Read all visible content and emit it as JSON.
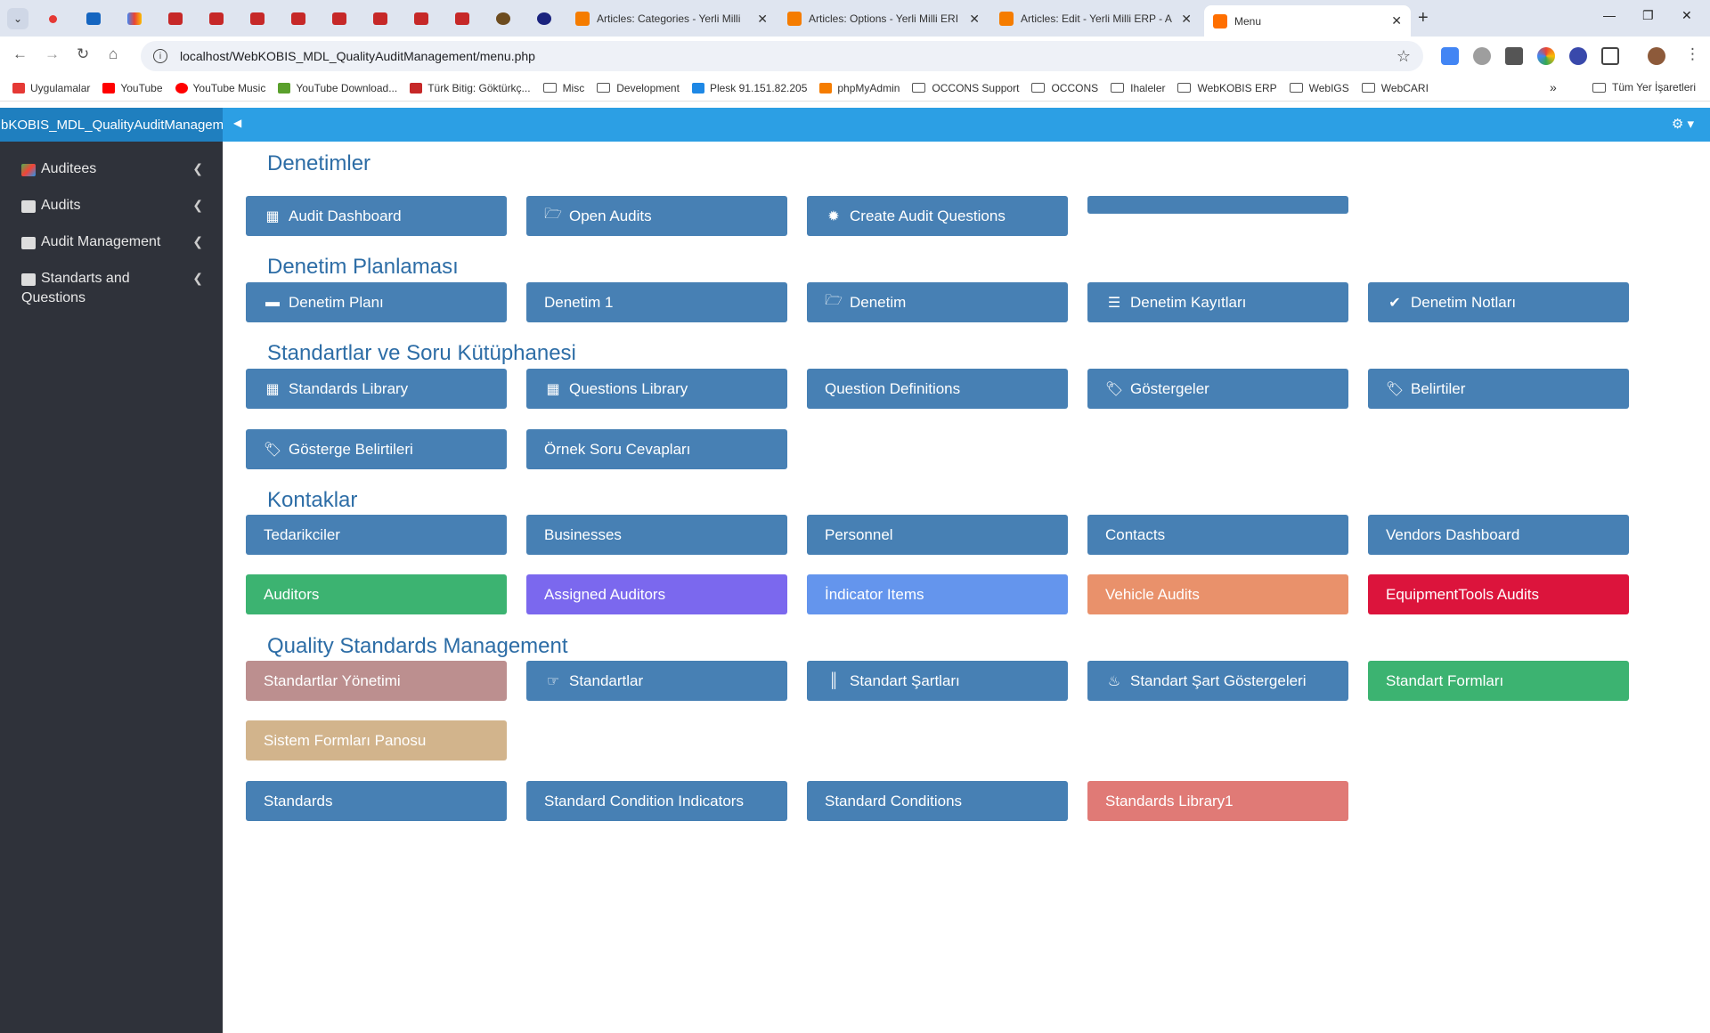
{
  "browser": {
    "active_tab": {
      "title": "Menu"
    },
    "tabs": [
      {
        "title": "Articles: Categories - Yerli Milli"
      },
      {
        "title": "Articles: Options - Yerli Milli ERI"
      },
      {
        "title": "Articles: Edit - Yerli Milli ERP - A"
      }
    ],
    "url": "localhost/WebKOBIS_MDL_QualityAuditManagement/menu.php",
    "bookmarks": [
      {
        "label": "Uygulamalar",
        "color": "#e53935"
      },
      {
        "label": "YouTube",
        "color": "#ff0000"
      },
      {
        "label": "YouTube Music",
        "color": "#ff0000"
      },
      {
        "label": "YouTube Download...",
        "color": "#5aa02c"
      },
      {
        "label": "Türk Bitig: Göktürkç...",
        "color": "#c62828"
      },
      {
        "label": "Misc",
        "folder": true
      },
      {
        "label": "Development",
        "folder": true
      },
      {
        "label": "Plesk 91.151.82.205",
        "color": "#1e88e5"
      },
      {
        "label": "phpMyAdmin",
        "color": "#f57c00"
      },
      {
        "label": "OCCONS Support",
        "folder": true
      },
      {
        "label": "OCCONS",
        "folder": true
      },
      {
        "label": "Ihaleler",
        "folder": true
      },
      {
        "label": "WebKOBIS ERP",
        "folder": true
      },
      {
        "label": "WebIGS",
        "folder": true
      },
      {
        "label": "WebCARI",
        "folder": true
      }
    ],
    "bookmarks_more": "»",
    "all_bookmarks": "Tüm Yer İşaretleri"
  },
  "app": {
    "title": "bKOBIS_MDL_QualityAuditManagem"
  },
  "sidebar": {
    "items": [
      {
        "label": "Auditees"
      },
      {
        "label": "Audits"
      },
      {
        "label": "Audit Management"
      },
      {
        "label": "Standarts and Questions"
      }
    ]
  },
  "sections": [
    {
      "title": "Denetimler"
    },
    {
      "title": "Denetim Planlaması"
    },
    {
      "title": "Standartlar ve Soru Kütüphanesi"
    },
    {
      "title": "Kontaklar"
    },
    {
      "title": "Quality Standards Management"
    }
  ],
  "tiles": {
    "audit_dashboard": "Audit Dashboard",
    "open_audits": "Open Audits",
    "create_audit_questions": "Create Audit Questions",
    "denetim_plani": "Denetim Planı",
    "denetim_1": "Denetim 1",
    "denetim": "Denetim",
    "denetim_kayitlari": "Denetim Kayıtları",
    "denetim_notlari": "Denetim Notları",
    "standards_library": "Standards Library",
    "questions_library": "Questions Library",
    "question_definitions": "Question Definitions",
    "gostergeler": "Göstergeler",
    "belirtiler": "Belirtiler",
    "gosterge_belirtileri": "Gösterge Belirtileri",
    "ornek_soru_cevaplari": "Örnek Soru Cevapları",
    "tedarikciler": "Tedarikciler",
    "businesses": "Businesses",
    "personnel": "Personnel",
    "contacts": "Contacts",
    "vendors_dashboard": "Vendors Dashboard",
    "auditors": "Auditors",
    "assigned_auditors": "Assigned Auditors",
    "indicator_items": "İndicator Items",
    "vehicle_audits": "Vehicle Audits",
    "equipmenttools_audits": "EquipmentTools Audits",
    "standartlar_yonetimi": "Standartlar Yönetimi",
    "standartlar": "Standartlar",
    "standart_sartlari": "Standart Şartları",
    "standart_sart_gostergeleri": "Standart Şart Göstergeleri",
    "standart_formlari": "Standart Formları",
    "sistem_formlari_panosu": "Sistem Formları Panosu",
    "standards": "Standards",
    "standard_condition_indicators": "Standard Condition Indicators",
    "standard_conditions": "Standard Conditions",
    "standards_library1": "Standards Library1"
  },
  "colors": {
    "header": "#2c9fe4",
    "sidebar": "#2f323a",
    "section_title": "#2d6da6",
    "tile_blue": "#4780b4",
    "tile_green": "#3cb371",
    "tile_purple": "#7b68ee",
    "tile_cornflower": "#6495ed",
    "tile_darksalmon": "#e9916b",
    "tile_crimson": "#dc143c",
    "tile_rosy": "#bc8f8f",
    "tile_tan": "#d2b48c",
    "tile_lightcoral": "#e07a76"
  }
}
